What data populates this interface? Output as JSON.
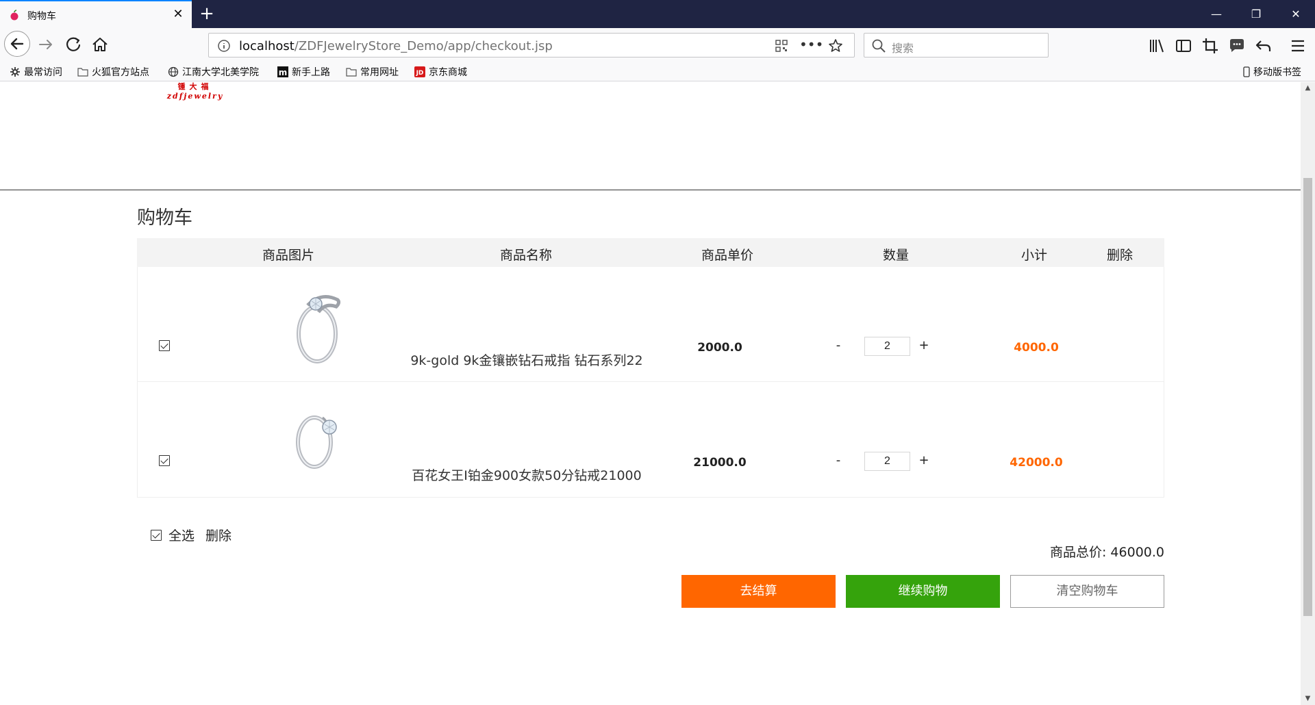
{
  "browser": {
    "tab_title": "购物车",
    "url_host": "localhost",
    "url_path": "/ZDFJewelryStore_Demo/app/checkout.jsp",
    "search_placeholder": "搜索",
    "bookmarks": [
      "最常访问",
      "火狐官方站点",
      "江南大学北美学院",
      "新手上路",
      "常用网址",
      "京东商城"
    ],
    "mobile_bookmarks": "移动版书签"
  },
  "logo": {
    "cn": "锺大福",
    "en": "zdfjewelry"
  },
  "cart": {
    "title": "购物车",
    "headers": [
      "商品图片",
      "商品名称",
      "商品单价",
      "数量",
      "小计",
      "删除"
    ],
    "items": [
      {
        "image": "silver-ring-twisted-icon",
        "name": "9k-gold 9k金镶嵌钻石戒指 钻石系列22",
        "price": "2000.0",
        "quantity": "2",
        "subtotal": "4000.0",
        "checked": true
      },
      {
        "image": "solitaire-ring-icon",
        "name": "百花女王I铂金900女款50分钻戒21000",
        "price": "21000.0",
        "quantity": "2",
        "subtotal": "42000.0",
        "checked": true
      }
    ],
    "minus_label": "-",
    "plus_label": "+",
    "select_all": "全选",
    "delete_selected": "删除",
    "total_label": "商品总价: 46000.0",
    "buttons": {
      "checkout": "去结算",
      "continue": "继续购物",
      "clear": "清空购物车"
    }
  },
  "colors": {
    "accent_orange": "#ff6600",
    "continue_green": "#35a30c",
    "tabbar_bg": "#1f2443"
  }
}
